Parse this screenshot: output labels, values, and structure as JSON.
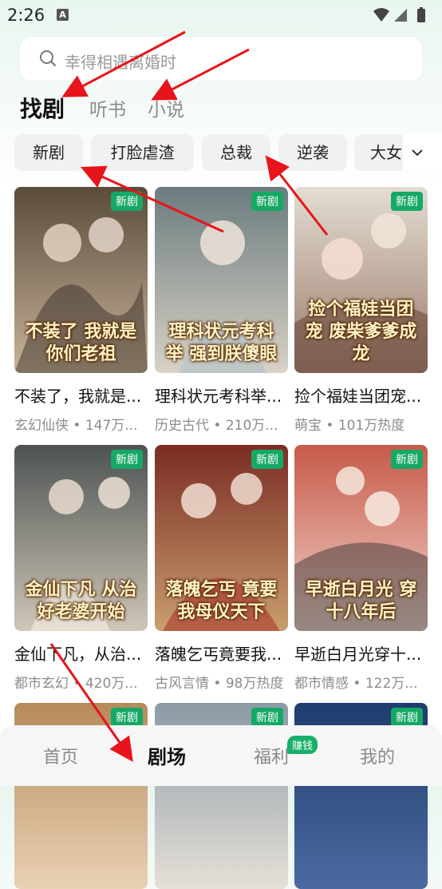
{
  "status": {
    "time": "2:26",
    "notification_icon": "A"
  },
  "search": {
    "placeholder": "幸得相遇离婚时"
  },
  "main_tabs": [
    {
      "label": "找剧",
      "active": true
    },
    {
      "label": "听书",
      "active": false
    },
    {
      "label": "小说",
      "active": false
    }
  ],
  "chips": [
    {
      "label": "新剧"
    },
    {
      "label": "打脸虐渣"
    },
    {
      "label": "总裁"
    },
    {
      "label": "逆袭"
    },
    {
      "label": "大女"
    }
  ],
  "badge_new": "新剧",
  "cards": [
    {
      "title": "不装了，我就是...",
      "meta": "玄幻仙侠 • 147万...",
      "poster_text": "不装了 我就是你们老祖",
      "colors": [
        "#5a4b3b",
        "#c8b49a"
      ]
    },
    {
      "title": "理科状元考科举...",
      "meta": "历史古代 • 210万...",
      "poster_text": "理科状元考科举 强到朕傻眼",
      "colors": [
        "#6b7c7f",
        "#d9d2c6"
      ]
    },
    {
      "title": "捡个福娃当团宠...",
      "meta": "萌宝 • 101万热度",
      "poster_text": "捡个福娃当团宠 废柴爹爹成龙",
      "colors": [
        "#e3ddd2",
        "#9b7b6a"
      ]
    },
    {
      "title": "金仙下凡，从治...",
      "meta": "都市玄幻 • 420万...",
      "poster_text": "金仙下凡 从治好老婆开始",
      "colors": [
        "#4d5352",
        "#cfc7b8"
      ]
    },
    {
      "title": "落魄乞丐竟要我...",
      "meta": "古风言情 • 98万热度",
      "poster_text": "落魄乞丐 竟要我母仪天下",
      "colors": [
        "#7b2c24",
        "#c99e6e"
      ]
    },
    {
      "title": "早逝白月光穿十...",
      "meta": "都市情感 • 122万...",
      "poster_text": "早逝白月光 穿十八年后",
      "colors": [
        "#c75a4a",
        "#f0d6cc"
      ]
    },
    {
      "title": "",
      "meta": "",
      "poster_text": "",
      "colors": [
        "#b68a5c",
        "#e9d2b4"
      ]
    },
    {
      "title": "",
      "meta": "",
      "poster_text": "",
      "colors": [
        "#8b9aa5",
        "#e6e0d8"
      ]
    },
    {
      "title": "",
      "meta": "",
      "poster_text": "",
      "colors": [
        "#1f3c6e",
        "#4b6aa0"
      ]
    }
  ],
  "bottom_nav": [
    {
      "label": "首页",
      "active": false
    },
    {
      "label": "剧场",
      "active": true
    },
    {
      "label": "福利",
      "active": false,
      "badge": "赚钱"
    },
    {
      "label": "我的",
      "active": false
    }
  ],
  "accent_color": "#16a865",
  "annotation_color": "#e8141b"
}
